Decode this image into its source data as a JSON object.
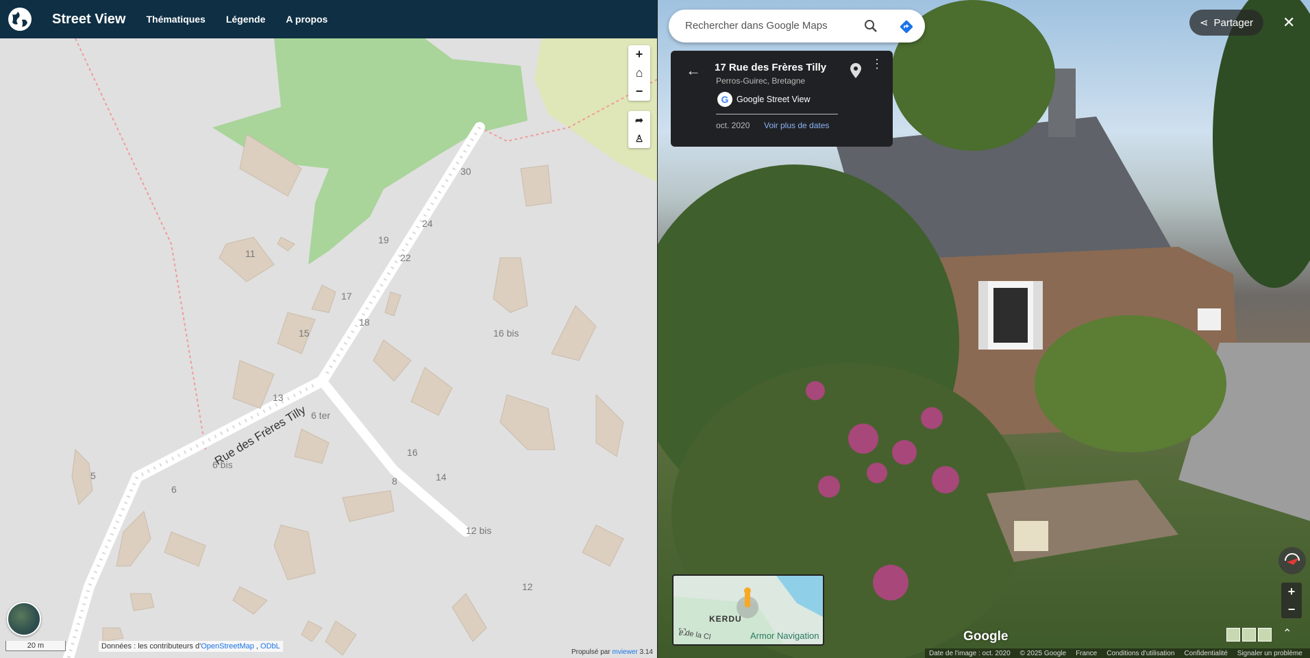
{
  "header": {
    "title": "Street View",
    "nav": [
      "Thématiques",
      "Légende",
      "A propos"
    ]
  },
  "map": {
    "street_name": "Rue des Frères Tilly",
    "house_numbers": [
      "30",
      "24",
      "19",
      "22",
      "11",
      "17",
      "15",
      "18",
      "16 bis",
      "13",
      "6 ter",
      "16",
      "8",
      "14",
      "5",
      "6 bis",
      "6",
      "12 bis",
      "12"
    ],
    "scale": "20 m",
    "attribution_prefix": "Données : les contributeurs d'",
    "attribution_link1": "OpenStreetMap",
    "attribution_sep": " , ",
    "attribution_link2": "ODbL",
    "powered_prefix": "Propulsé par ",
    "powered_link": "mviewer",
    "powered_version": " 3.14",
    "controls": {
      "zoom_in": "+",
      "home": "⌂",
      "zoom_out": "−",
      "share": "➦",
      "pegman": "♙"
    }
  },
  "streetview": {
    "search_placeholder": "Rechercher dans Google Maps",
    "address": "17 Rue des Frères Tilly",
    "city": "Perros-Guirec, Bretagne",
    "provider": "Google Street View",
    "date": "oct. 2020",
    "more_dates": "Voir plus de dates",
    "share_label": "Partager",
    "close": "✕",
    "google": "Google",
    "minimap": {
      "place": "KERDU",
      "business": "Armor Navigation",
      "road": "e de la Cl"
    },
    "footer": [
      "Date de l'image : oct. 2020",
      "© 2025 Google",
      "France",
      "Conditions d'utilisation",
      "Confidentialité",
      "Signaler un problème"
    ],
    "zoom_in": "+",
    "zoom_out": "−",
    "expand": "⌃"
  }
}
